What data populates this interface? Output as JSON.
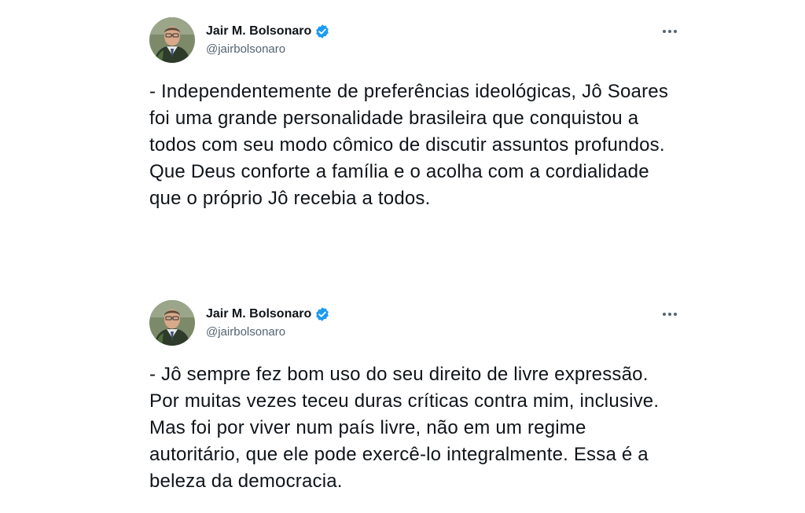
{
  "tweets": [
    {
      "author": {
        "name": "Jair M. Bolsonaro",
        "handle": "@jairbolsonaro",
        "verified": true
      },
      "text": "- Independentemente de preferências ideológicas, Jô Soares foi uma grande personalidade brasileira que conquistou a todos com seu modo cômico de discutir assuntos profundos. Que Deus conforte a família e o acolha com a cordialidade que o próprio Jô recebia a todos.",
      "menu_icon": "more-horizontal-icon"
    },
    {
      "author": {
        "name": "Jair M. Bolsonaro",
        "handle": "@jairbolsonaro",
        "verified": true
      },
      "text": "- Jô sempre fez bom uso do seu direito de livre expressão. Por muitas vezes teceu duras críticas contra mim, inclusive. Mas foi por viver num país livre, não em um regime autoritário, que ele pode exercê-lo integralmente. Essa é a beleza da democracia.",
      "menu_icon": "more-horizontal-icon"
    }
  ],
  "colors": {
    "text_primary": "#0f1419",
    "text_secondary": "#536471",
    "verified_blue": "#1d9bf0",
    "background": "#ffffff"
  }
}
